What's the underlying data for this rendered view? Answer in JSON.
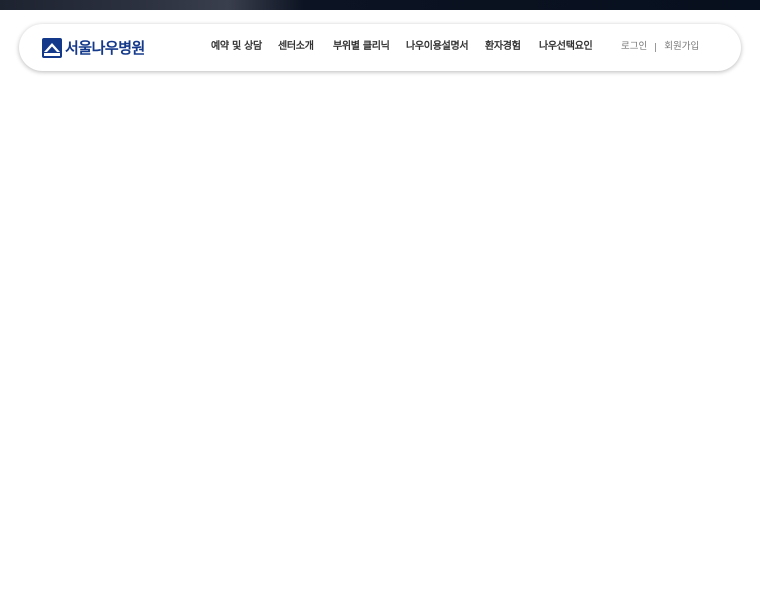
{
  "header": {
    "logo": {
      "icon": "hospital-logo-icon",
      "name": "서울나우병원",
      "brand_color": "#14398a"
    },
    "nav": [
      {
        "label": "예약 및 상담"
      },
      {
        "label": "센터소개"
      },
      {
        "label": "부위별 클리닉"
      },
      {
        "label": "나우이용설명서"
      },
      {
        "label": "환자경험"
      },
      {
        "label": "나우선택요인"
      }
    ],
    "util": {
      "login": "로그인",
      "signup": "회원가입"
    }
  }
}
